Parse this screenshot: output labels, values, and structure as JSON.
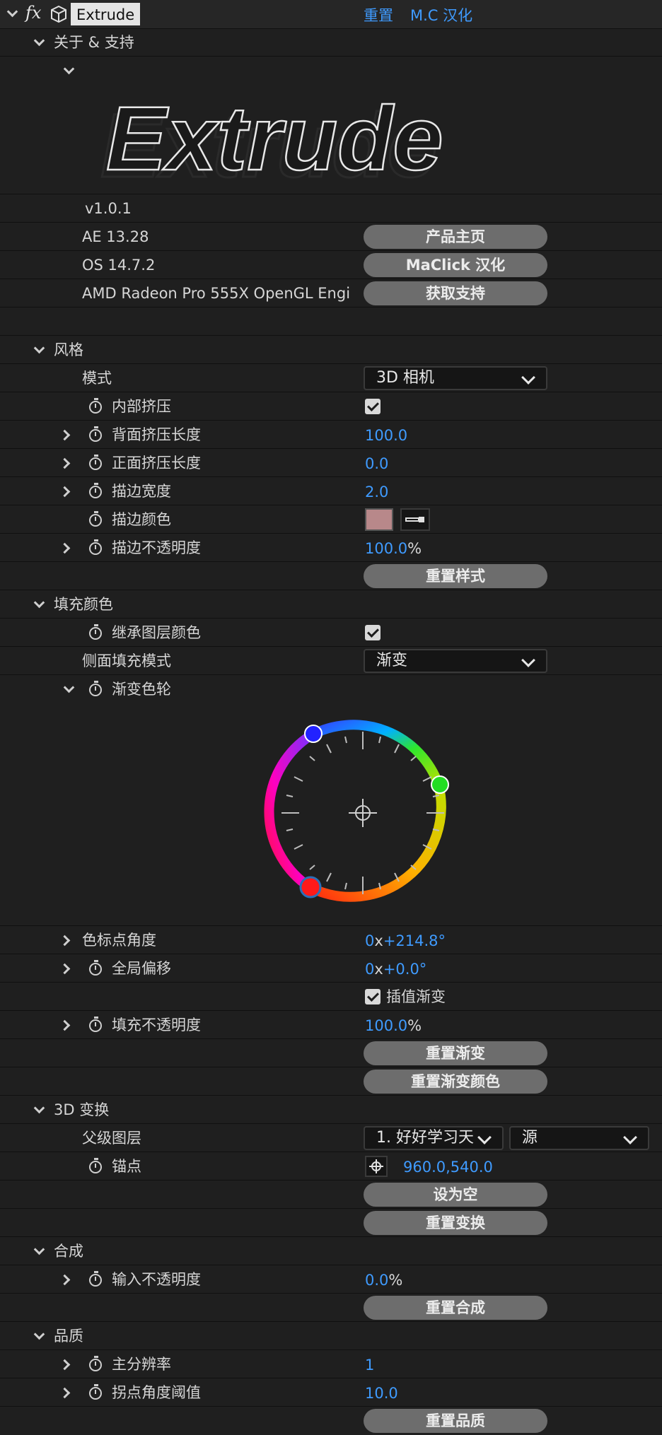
{
  "header": {
    "fx": "fx",
    "effect_name": "Extrude",
    "reset": "重置",
    "localize": "M.C 汉化"
  },
  "about": {
    "title": "关于 & 支持",
    "logo_text": "Extrude",
    "version": "v1.0.1",
    "ae": "AE 13.28",
    "os": "OS 14.7.2",
    "gpu": "AMD Radeon Pro 555X OpenGL Engi",
    "btn_home": "产品主页",
    "btn_maclick": "MaClick 汉化",
    "btn_support": "获取支持"
  },
  "style": {
    "title": "风格",
    "mode_label": "模式",
    "mode_value": "3D 相机",
    "inner": "内部挤压",
    "back_len": "背面挤压长度",
    "back_len_val": "100.0",
    "front_len": "正面挤压长度",
    "front_len_val": "0.0",
    "stroke_w": "描边宽度",
    "stroke_w_val": "2.0",
    "stroke_color": "描边颜色",
    "stroke_color_hex": "#b8888a",
    "stroke_op": "描边不透明度",
    "stroke_op_val": "100.0",
    "pct": "%",
    "reset_style": "重置样式"
  },
  "fill": {
    "title": "填充颜色",
    "inherit": "继承图层颜色",
    "side_mode": "侧面填充模式",
    "side_mode_val": "渐变",
    "wheel": "渐变色轮",
    "marker_angle": "色标点角度",
    "marker_angle_x": "0",
    "marker_angle_val": "+214.8°",
    "global_offset": "全局偏移",
    "global_offset_x": "0",
    "global_offset_val": "+0.0°",
    "interp": "插值渐变",
    "fill_op": "填充不透明度",
    "fill_op_val": "100.0",
    "pct": "%",
    "x": "x",
    "reset_grad": "重置渐变",
    "reset_grad_color": "重置渐变颜色"
  },
  "transform": {
    "title": "3D 变换",
    "parent": "父级图层",
    "parent_val": "1. 好好学习天",
    "source_val": "源",
    "anchor": "锚点",
    "anchor_val": "960.0,540.0",
    "set_null": "设为空",
    "reset_transform": "重置变换"
  },
  "comp": {
    "title": "合成",
    "input_op": "输入不透明度",
    "input_op_val": "0.0",
    "pct": "%",
    "reset": "重置合成"
  },
  "quality": {
    "title": "品质",
    "res": "主分辨率",
    "res_val": "1",
    "corner": "拐点角度阈值",
    "corner_val": "10.0",
    "reset": "重置品质"
  }
}
